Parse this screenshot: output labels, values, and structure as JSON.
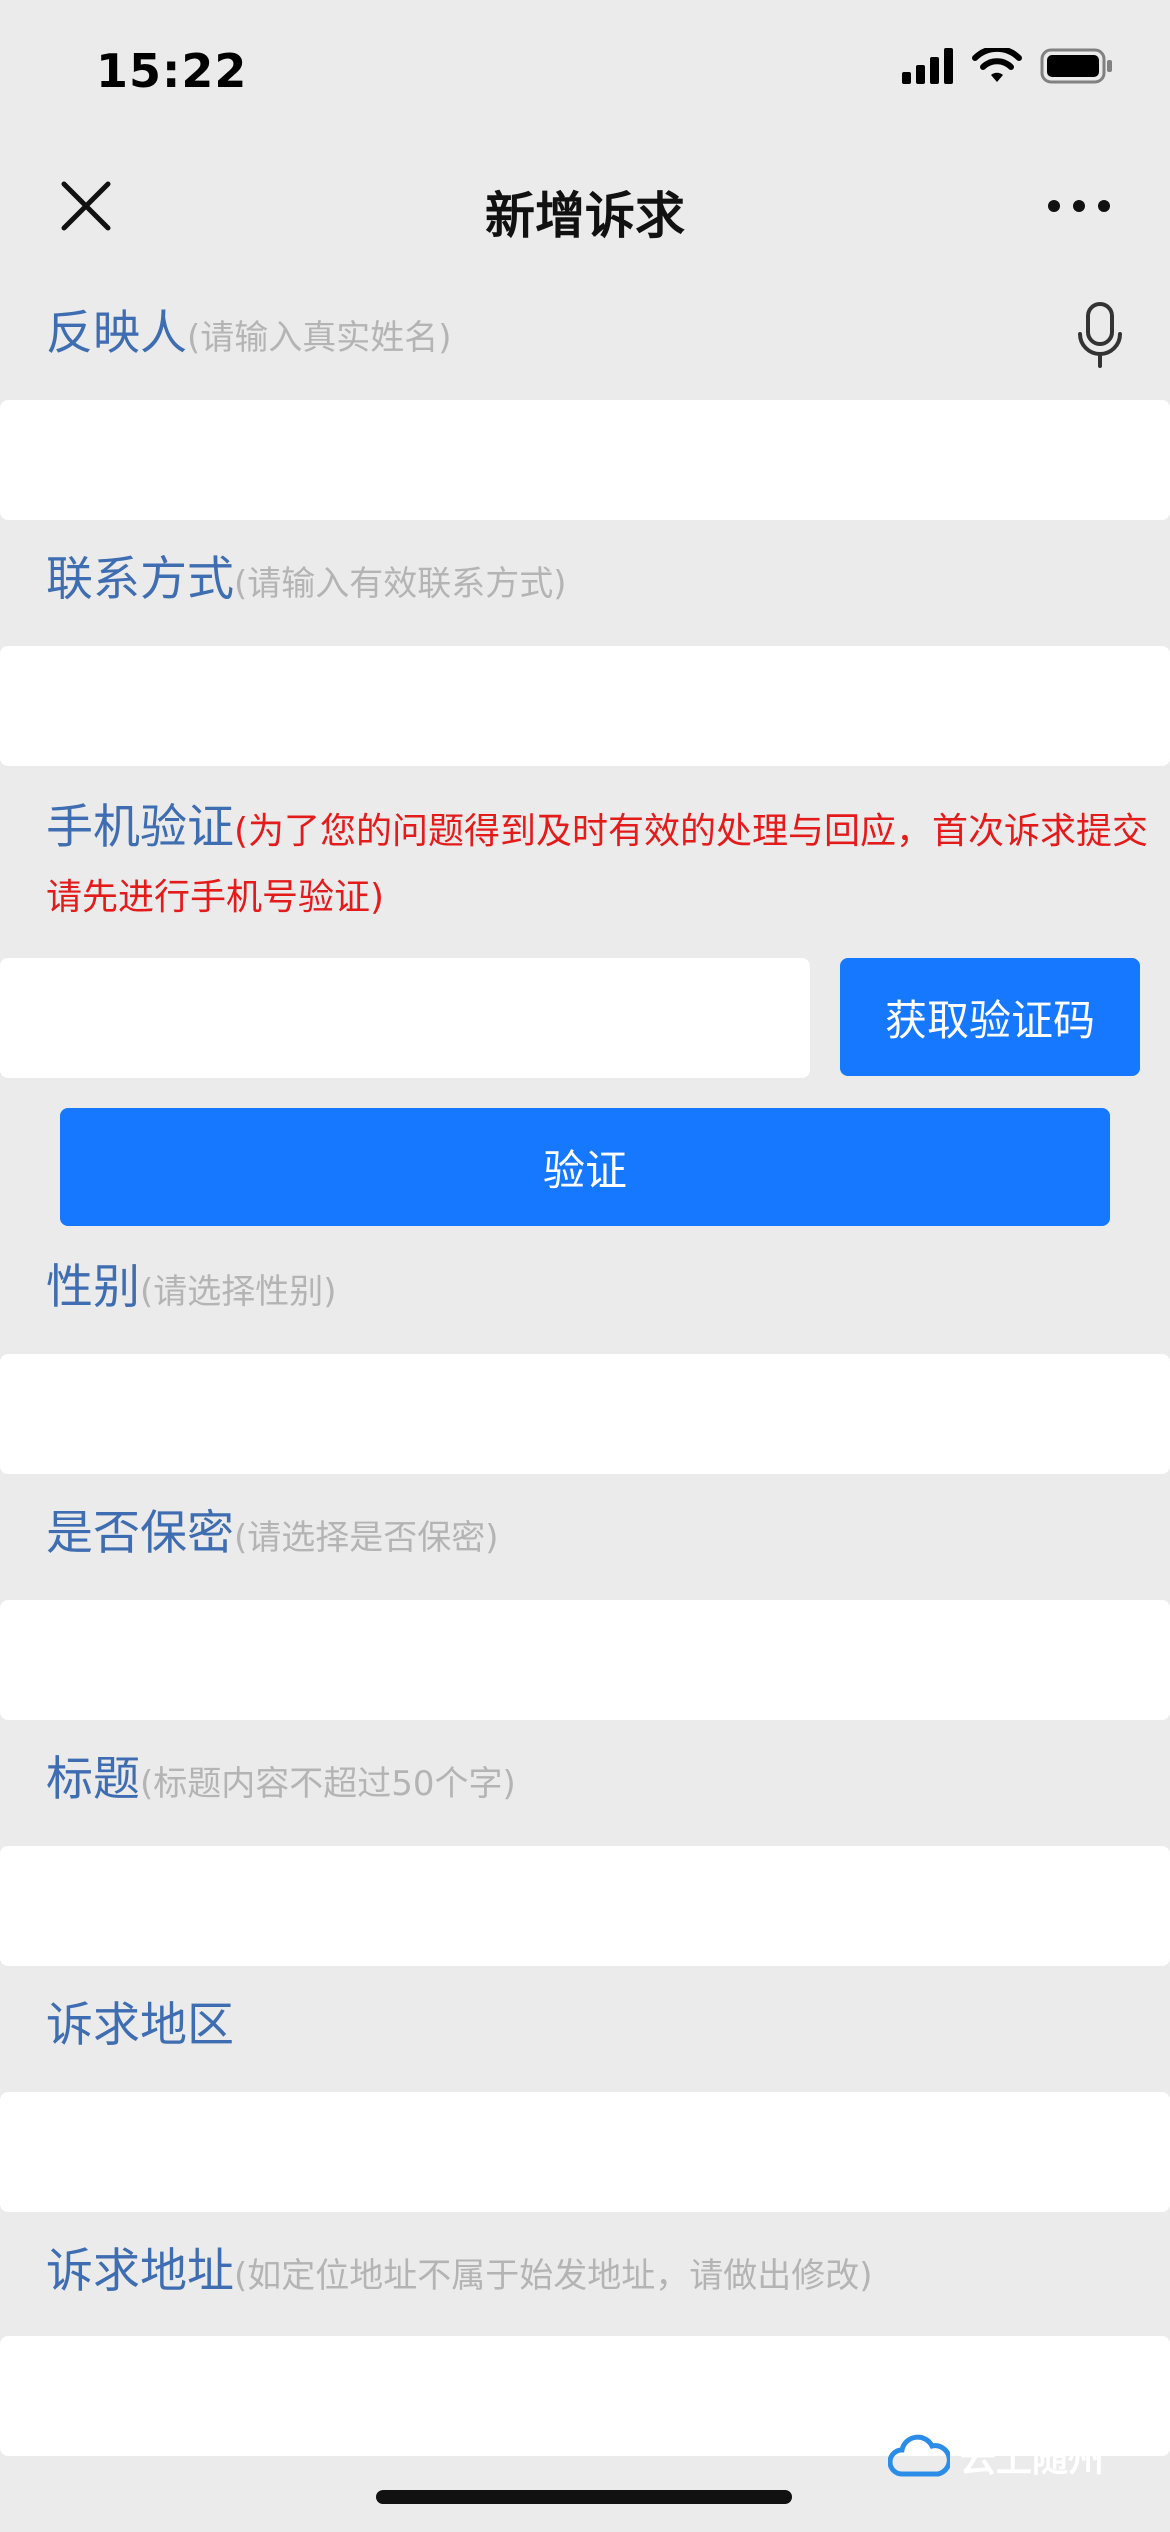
{
  "status": {
    "time": "15:22"
  },
  "nav": {
    "title": "新增诉求"
  },
  "fields": {
    "name": {
      "label": "反映人",
      "hint": "(请输入真实姓名)"
    },
    "contact": {
      "label": "联系方式",
      "hint": "(请输入有效联系方式)"
    },
    "phone_verify": {
      "label": "手机验证",
      "hint_line1": "(为了您的问题得到及时有效的处理与回应，首次诉求提交",
      "hint_line2": "请先进行手机号验证)",
      "get_code_label": "获取验证码",
      "verify_label": "验证"
    },
    "gender": {
      "label": "性别",
      "hint": "(请选择性别)"
    },
    "confidential": {
      "label": "是否保密",
      "hint": "(请选择是否保密)"
    },
    "title": {
      "label": "标题",
      "hint": "(标题内容不超过50个字)"
    },
    "region": {
      "label": "诉求地区"
    },
    "address": {
      "label": "诉求地址",
      "hint": "(如定位地址不属于始发地址，请做出修改)"
    }
  },
  "watermark": {
    "text": "云上随州"
  },
  "colors": {
    "accent": "#1677ff",
    "label": "#3f6db1",
    "hint": "#b4b4b4",
    "warning": "#e41b1b",
    "background": "#ebebeb"
  }
}
